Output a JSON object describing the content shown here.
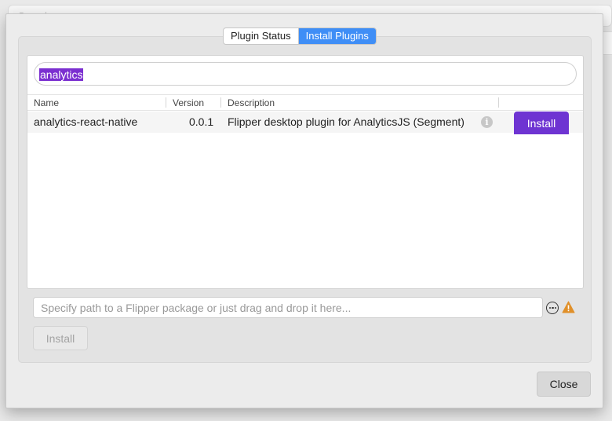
{
  "background": {
    "field_label": "Search"
  },
  "tabs": [
    {
      "label": "Plugin Status",
      "active": false
    },
    {
      "label": "Install Plugins",
      "active": true
    }
  ],
  "search": {
    "value": "analytics"
  },
  "table": {
    "columns": [
      "Name",
      "Version",
      "Description"
    ],
    "rows": [
      {
        "name": "analytics-react-native",
        "version": "0.0.1",
        "description": "Flipper desktop plugin for AnalyticsJS (Segment)",
        "action_label": "Install"
      }
    ]
  },
  "path_input": {
    "placeholder": "Specify path to a Flipper package or just drag and drop it here..."
  },
  "install_file_button": {
    "label": "Install"
  },
  "close_button": {
    "label": "Close"
  },
  "colors": {
    "accent_tab": "#3f8ef6",
    "install_button": "#6e34d2",
    "search_highlight": "#7b2fd0",
    "warning": "#e0902a"
  },
  "icons": {
    "info": "info-icon",
    "more": "ellipsis-circle-icon",
    "warning": "warning-icon"
  }
}
